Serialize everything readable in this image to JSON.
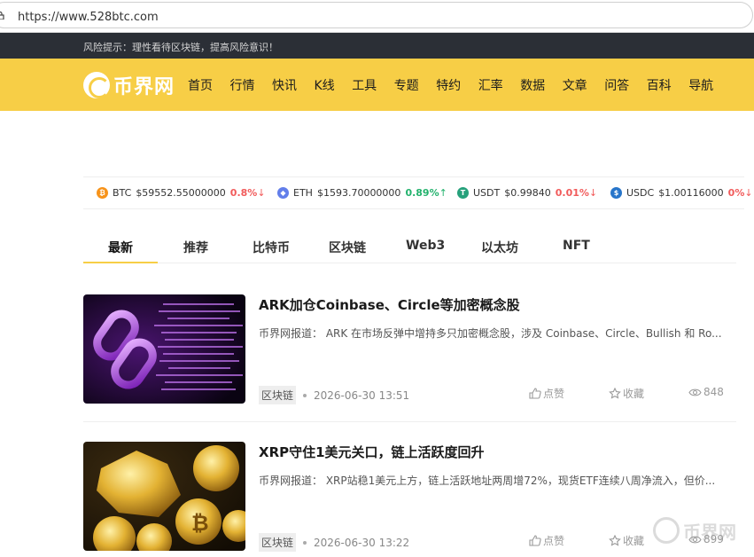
{
  "browser": {
    "url": "https://www.528btc.com"
  },
  "risk_notice": "风险提示：理性看待区块链，提高风险意识！",
  "logo": {
    "text": "币界网"
  },
  "nav": [
    "首页",
    "行情",
    "快讯",
    "K线",
    "工具",
    "专题",
    "特约",
    "汇率",
    "数据",
    "文章",
    "问答",
    "百科",
    "导航"
  ],
  "ticker": [
    {
      "symbol": "BTC",
      "price": "$59552.55000000",
      "change": "0.8%",
      "arrow": "↓",
      "direction": "down",
      "color": "#f7931a",
      "icon": "btc-icon"
    },
    {
      "symbol": "ETH",
      "price": "$1593.70000000",
      "change": "0.89%",
      "arrow": "↑",
      "direction": "up",
      "color": "#627eea",
      "icon": "eth-icon"
    },
    {
      "symbol": "USDT",
      "price": "$0.99840",
      "change": "0.01%",
      "arrow": "↓",
      "direction": "down",
      "color": "#26a17b",
      "icon": "usdt-icon"
    },
    {
      "symbol": "USDC",
      "price": "$1.00116000",
      "change": "0%",
      "arrow": "↓",
      "direction": "down",
      "color": "#2775ca",
      "icon": "usdc-icon"
    }
  ],
  "tabs": [
    "最新",
    "推荐",
    "比特币",
    "区块链",
    "Web3",
    "以太坊",
    "NFT"
  ],
  "articles": [
    {
      "title": "ARK加仓Coinbase、Circle等加密概念股",
      "summary": "币界网报道： ARK 在市场反弹中增持多只加密概念股，涉及 Coinbase、Circle、Bullish 和 Ro...",
      "tag": "区块链",
      "time": "2026-06-30 13:51",
      "like_label": "点赞",
      "fav_label": "收藏",
      "views": "848",
      "thumb": "chain-link-image"
    },
    {
      "title": "XRP守住1美元关口，链上活跃度回升",
      "summary": "币界网报道： XRP站稳1美元上方，链上活跃地址两周增72%，现货ETF连续八周净流入，但价...",
      "tag": "区块链",
      "time": "2026-06-30 13:22",
      "like_label": "点赞",
      "fav_label": "收藏",
      "views": "899",
      "thumb": "gold-coins-image"
    }
  ]
}
